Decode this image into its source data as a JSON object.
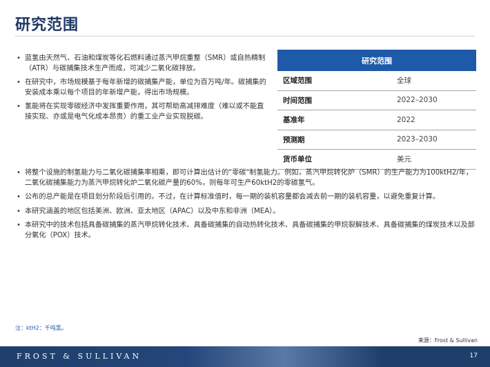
{
  "title": "研究范围",
  "top_bullets": [
    "蓝氢由天然气、石油和煤炭等化石燃料通过蒸汽甲烷重整（SMR）或自热精制（ATR）与碳捕集技术生产而成，可减少二氧化碳排放。",
    "在研究中，市场规模基于每年新增的碳捕集产能，单位为百万吨/年。碳捕集的安装成本乘以每个项目的年新增产能，得出市场规模。",
    "氢能将在实现零碳经济中发挥重要作用，其可帮助高减排难度（难以或不能直接实现、亦或是电气化成本昂贵）的重工业产业实现脱碳。"
  ],
  "bottom_bullets": [
    "将整个设施的制氢能力与二氧化碳捕集率相乘，即可计算出估计的\"零碳\"制氢能力。例如，蒸汽甲烷转化炉（SMR）的生产能力为100ktH2/年，二氧化碳捕集能力为蒸汽甲烷转化炉二氧化碳产量的60%，则每年可生产60ktH2的零碳氢气。",
    "公布的总产能是在项目划分阶段后引用的。不过，在计算标准值时，每一期的装机容量都会减去前一期的装机容量，以避免重复计算。",
    "本研究涵盖的地区包括美洲、欧洲、亚太地区（APAC）以及中东和非洲（MEA）。",
    "本研究中的技术包括具备碳捕集的蒸汽甲烷转化技术、具备碳捕集的自动热转化技术、具备碳捕集的甲烷裂解技术、具备碳捕集的煤炭技术以及部分氧化（POX）技术。"
  ],
  "scope_table": {
    "header": "研究范围",
    "rows": [
      {
        "key": "区域范围",
        "value": "全球"
      },
      {
        "key": "时间范围",
        "value": "2022–2030"
      },
      {
        "key": "基准年",
        "value": "2022"
      },
      {
        "key": "预测期",
        "value": "2023–2030"
      },
      {
        "key": "货币单位",
        "value": "美元"
      }
    ]
  },
  "note": "注：ktH2：千吨氢。",
  "source": "来源：Frost & Sullivan",
  "footer": {
    "brand": "FROST & SULLIVAN",
    "page_number": "17"
  },
  "colors": {
    "title": "#1f3864",
    "table_header": "#1e5aa8",
    "footer": "#1f3f6b"
  }
}
